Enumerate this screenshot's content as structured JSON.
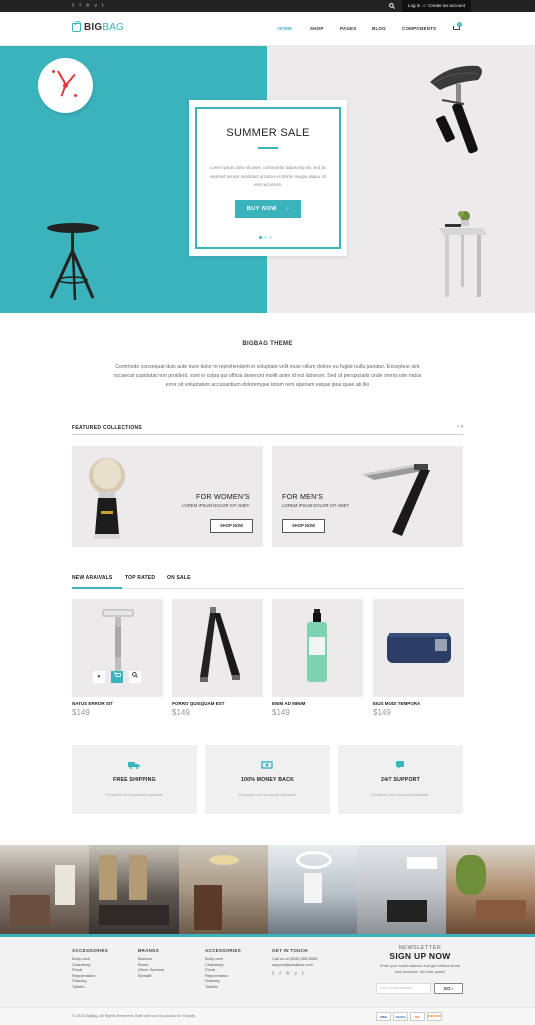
{
  "topbar": {
    "social_icons": [
      "twitter-icon",
      "facebook-icon",
      "pinterest-icon",
      "vimeo-icon",
      "tumblr-icon"
    ],
    "social_glyphs": [
      "𝕥",
      "f",
      "℗",
      "v",
      "t"
    ],
    "login": "Log in",
    "or": "or",
    "create_account": "Create an account"
  },
  "header": {
    "logo_big": "BIG",
    "logo_bag": "BAG",
    "nav": [
      "HOME",
      "SHOP",
      "PAGES",
      "BLOG",
      "COMPONENTS"
    ],
    "cart_count": "0"
  },
  "hero": {
    "title": "SUMMER SALE",
    "text": "Lorem ipsum dolor sit amet, consectetur adipiscing elit, sed do eiusmod tempor incididunt ut labore et dolore magna aliqua. Ut enim ad minim.",
    "button": "BUY NOW",
    "button_arrow": "›"
  },
  "theme": {
    "title": "BIGBAG THEME",
    "text": "Commodo consequat duis aute irure dolor in reprehenderit in voluptate velit esse cillum dolore eu fugiat nulla pariatur. Excepteur sint occaecat cupidatat non proident, sunt in culpa qui officia deserunt mollit anim id est laborum. Sed ut perspiciatis unde omnis iste natus error sit voluptatem accusantium doloremque  totam rem aperiam eaque ipsa quae ab illo"
  },
  "featured": {
    "heading": "FEATURED COLLECTIONS",
    "prev": "‹",
    "next": "›",
    "cards": [
      {
        "name": "FOR WOMEN'S",
        "sub": "LOREM IPSUM DOLOR SIT AMET",
        "button": "SHOP NOW"
      },
      {
        "name": "FOR MEN'S",
        "sub": "LOREM IPSUM DOLOR SIT AMET",
        "button": "SHOP NOW"
      }
    ]
  },
  "tabs": [
    "NEW ARAIVALS",
    "TOP RATED",
    "ON SALE"
  ],
  "products": [
    {
      "name": "NATUS ERROR SIT",
      "price": "$149"
    },
    {
      "name": "PORRO QUISQUAM EST",
      "price": "$149"
    },
    {
      "name": "ENIM AD MINIM",
      "price": "$149"
    },
    {
      "name": "EIUS MODI TEMPORA",
      "price": "$149"
    }
  ],
  "product_hover": {
    "wishlist": "♥",
    "cart": "🛒",
    "search": "⌕"
  },
  "features": [
    {
      "title": "FREE SHIPPING",
      "sub": "Excepteur sint occaecat cupidatat.",
      "icon": "truck-icon"
    },
    {
      "title": "100% MONEY BACK",
      "sub": "Excepteur sint occaecat cupidatat.",
      "icon": "money-icon"
    },
    {
      "title": "24/7 SUPPORT",
      "sub": "Excepteur sint occaecat cupidatat.",
      "icon": "chat-icon"
    }
  ],
  "footer": {
    "columns": [
      {
        "heading": "ACCESSORIES",
        "items": [
          "Body care",
          "Chambray",
          "Floral",
          "Rejuvenation",
          "Shaving",
          "Toilette"
        ]
      },
      {
        "heading": "BRANDS",
        "items": [
          "Barbour",
          "Brioni",
          "Oliver Spencer",
          "Belstaff"
        ]
      },
      {
        "heading": "ACCESSORIES",
        "items": [
          "Body care",
          "Chambray",
          "Floral",
          "Rejuvenation",
          "Shaving",
          "Toilette"
        ]
      }
    ],
    "contact_heading": "GET IN TOUCH",
    "contact_lines": [
      "Call us at (555)-555-5555",
      "support@amaklus.com"
    ],
    "newsletter_small": "NEWSLETTER",
    "newsletter_big": "SIGN UP NOW",
    "newsletter_text": "Enter your email address and get notified about new products. We hate spam!",
    "email_placeholder": "your email address",
    "go": "GO",
    "go_arrow": "›",
    "copyright": "© 2015 BigBag. All Rights Reserved. Built with love by Alodus for Shopify.",
    "payments": [
      "VISA",
      "PayPal",
      "MC",
      "DISCOVER"
    ]
  },
  "colors": {
    "accent": "#3bb3bd",
    "hero_left": "#3bb3bd",
    "hero_right": "#eceaeb",
    "dark": "#222222"
  }
}
